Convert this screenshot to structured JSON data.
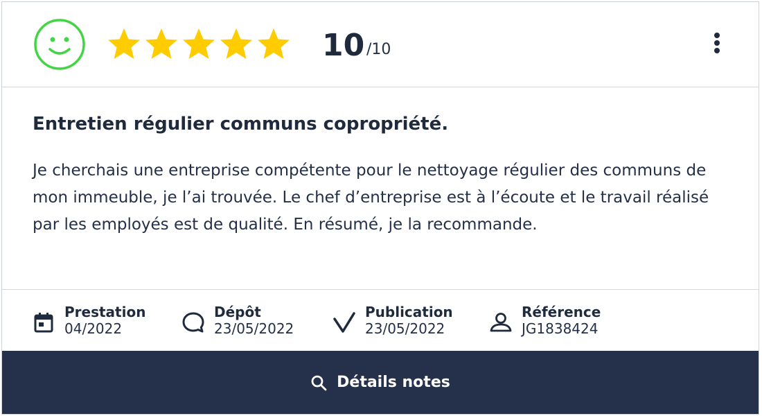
{
  "review": {
    "score": "10",
    "score_max": "/10",
    "stars": 5,
    "rating_icon": "smiley-icon",
    "title": "Entretien régulier communs copropriété.",
    "body": "Je cherchais une entreprise compétente pour le nettoyage régulier des communs de mon immeuble, je l’ai trouvée. Le chef d’entreprise est à l’écoute et le travail réalisé par les employés est de qualité. En résumé, je la recommande."
  },
  "meta": [
    {
      "label": "Prestation",
      "value": "04/2022",
      "icon": "calendar-icon"
    },
    {
      "label": "Dépôt",
      "value": "23/05/2022",
      "icon": "speech-bubble-icon"
    },
    {
      "label": "Publication",
      "value": "23/05/2022",
      "icon": "checkmark-icon"
    },
    {
      "label": "Référence",
      "value": "JG1838424",
      "icon": "user-icon"
    }
  ],
  "footer": {
    "label": "Détails notes",
    "icon": "search-icon"
  },
  "colors": {
    "star": "#FFCC00",
    "smiley": "#44D445",
    "footer_bg": "#25314A",
    "text": "#243047"
  }
}
